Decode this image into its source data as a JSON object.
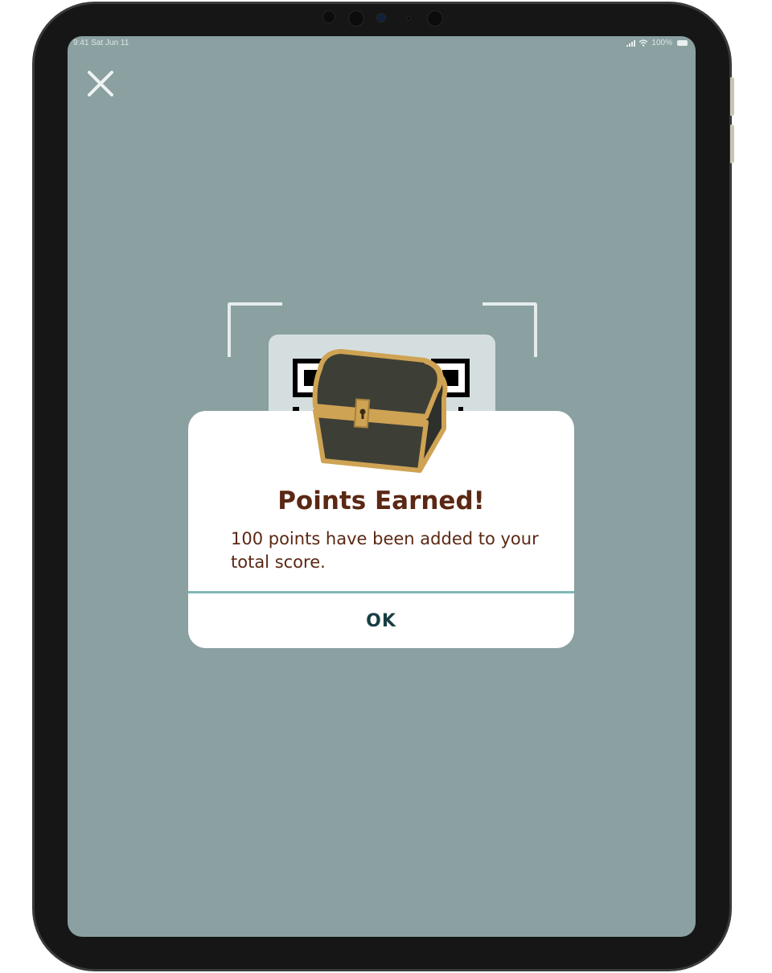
{
  "status_bar": {
    "time_date": "9:41  Sat Jun 11",
    "battery": "100%"
  },
  "icons": {
    "close": "close-icon",
    "chest": "treasure-chest-icon",
    "qr": "qr-code-icon",
    "signal": "cellular-signal-icon",
    "wifi": "wifi-icon",
    "battery": "battery-icon"
  },
  "colors": {
    "background": "#8aa0a1",
    "title_text": "#5b2814",
    "divider": "#7fb8b9",
    "button_text": "#173f43",
    "chest_body": "#3d3f36",
    "chest_trim": "#cfa354"
  },
  "dialog": {
    "title": "Points Earned!",
    "message": "100 points have been added to your total score.",
    "ok_label": "OK"
  }
}
